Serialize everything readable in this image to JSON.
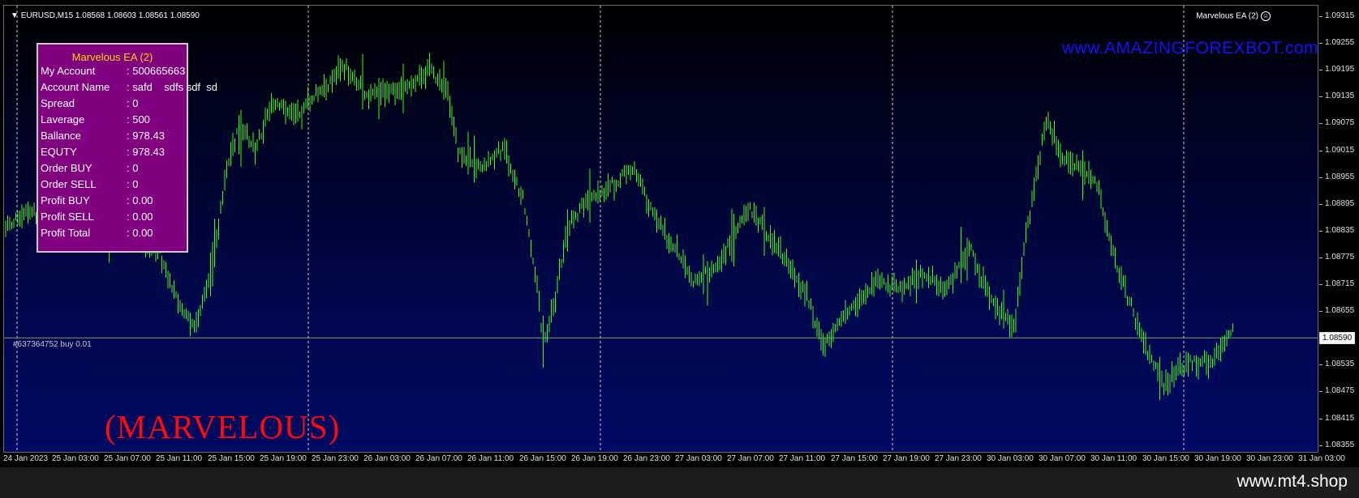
{
  "chart": {
    "symbol_header": "EURUSD,M15  1.08568 1.08603 1.08561 1.08590",
    "ea_badge": "Marvelous EA (2)",
    "brand_link": "www.AMAZINGFOREXBOT.com",
    "watermark": "(MARVELOUS)",
    "order_label": "#637364752 buy 0.01",
    "current_price": "1.08590",
    "colors": {
      "candles": "#39ff14",
      "order_line": "#7f9a6a",
      "grid": "#d0d0d0",
      "panel_bg": "#800080",
      "panel_title": "#ffd400"
    }
  },
  "price_axis": {
    "labels": [
      "1.09315",
      "1.09255",
      "1.09195",
      "1.09135",
      "1.09075",
      "1.09015",
      "1.08955",
      "1.08895",
      "1.08835",
      "1.08775",
      "1.08715",
      "1.08655",
      "1.08590",
      "1.08535",
      "1.08475",
      "1.08415",
      "1.08355"
    ]
  },
  "time_axis": {
    "labels": [
      "24 Jan 2023",
      "25 Jan 03:00",
      "25 Jan 07:00",
      "25 Jan 11:00",
      "25 Jan 15:00",
      "25 Jan 19:00",
      "25 Jan 23:00",
      "26 Jan 03:00",
      "26 Jan 07:00",
      "26 Jan 11:00",
      "26 Jan 15:00",
      "26 Jan 19:00",
      "26 Jan 23:00",
      "27 Jan 03:00",
      "27 Jan 07:00",
      "27 Jan 11:00",
      "27 Jan 15:00",
      "27 Jan 19:00",
      "27 Jan 23:00",
      "30 Jan 03:00",
      "30 Jan 07:00",
      "30 Jan 11:00",
      "30 Jan 15:00",
      "30 Jan 19:00",
      "30 Jan 23:00",
      "31 Jan 03:00"
    ]
  },
  "panel": {
    "title": "Marvelous EA (2)",
    "rows": [
      {
        "label": "My Account",
        "value": ": 500665663"
      },
      {
        "label": "Account Name",
        "value": ": safd    sdfs sdf  sd"
      },
      {
        "label": "Spread",
        "value": ": 0"
      },
      {
        "label": "Laverage",
        "value": ": 500"
      },
      {
        "label": "Ballance",
        "value": ": 978.43"
      },
      {
        "label": "EQUTY",
        "value": ": 978.43"
      },
      {
        "label": "Order BUY",
        "value": ": 0"
      },
      {
        "label": "Order SELL",
        "value": ": 0"
      },
      {
        "label": "Profit BUY",
        "value": ": 0.00"
      },
      {
        "label": "Profit SELL",
        "value": ": 0.00"
      },
      {
        "label": "Profit Total",
        "value": ": 0.00"
      }
    ]
  },
  "footer": {
    "text": "www.mt4.shop"
  }
}
